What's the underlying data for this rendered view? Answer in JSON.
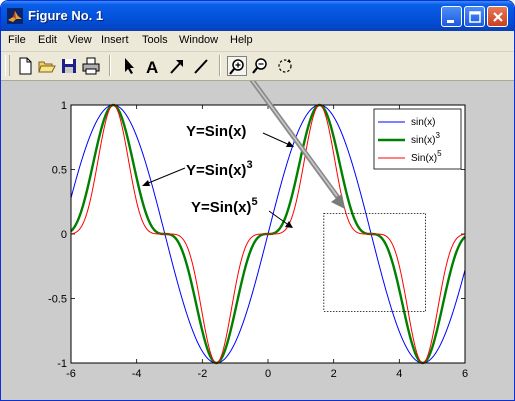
{
  "window": {
    "title": "Figure No. 1"
  },
  "menu": [
    "File",
    "Edit",
    "View",
    "Insert",
    "Tools",
    "Window",
    "Help"
  ],
  "toolbar": {
    "tools": [
      "new-file-icon",
      "open-folder-icon",
      "save-icon",
      "print-icon",
      "pointer-arrow-icon",
      "insert-text-icon",
      "insert-arrow-icon",
      "insert-line-icon",
      "zoom-in-icon",
      "zoom-out-icon",
      "rotate-3d-icon"
    ],
    "pressed": "zoom-in-icon"
  },
  "chart_data": {
    "type": "line",
    "x_range": [
      -6,
      6
    ],
    "ylim": [
      -1,
      1
    ],
    "xticks": [
      "-6",
      "-4",
      "-2",
      "0",
      "2",
      "4",
      "6"
    ],
    "yticks": [
      "1",
      "0.5",
      "0",
      "-0.5",
      "-1"
    ],
    "xtick_values": [
      -6,
      -4,
      -2,
      0,
      2,
      4,
      6
    ],
    "ytick_values": [
      1,
      0.5,
      0,
      -0.5,
      -1
    ],
    "series": [
      {
        "name": "sin(x)",
        "sup": "",
        "power": 1,
        "color": "#0000ff"
      },
      {
        "name": "sin(x)",
        "sup": "3",
        "power": 3,
        "color": "#008000"
      },
      {
        "name": "Sin(x)",
        "sup": "5",
        "power": 5,
        "color": "#ff0000"
      }
    ],
    "legend_position": "top-right",
    "annotations": [
      {
        "text": "Y=Sin(x)",
        "sup": ""
      },
      {
        "text": "Y=Sin(x)",
        "sup": "3"
      },
      {
        "text": "Y=Sin(x)",
        "sup": "5"
      }
    ],
    "zoom_box": {
      "x": [
        1.7,
        4.8
      ],
      "y": [
        -0.6,
        0.16
      ]
    }
  }
}
